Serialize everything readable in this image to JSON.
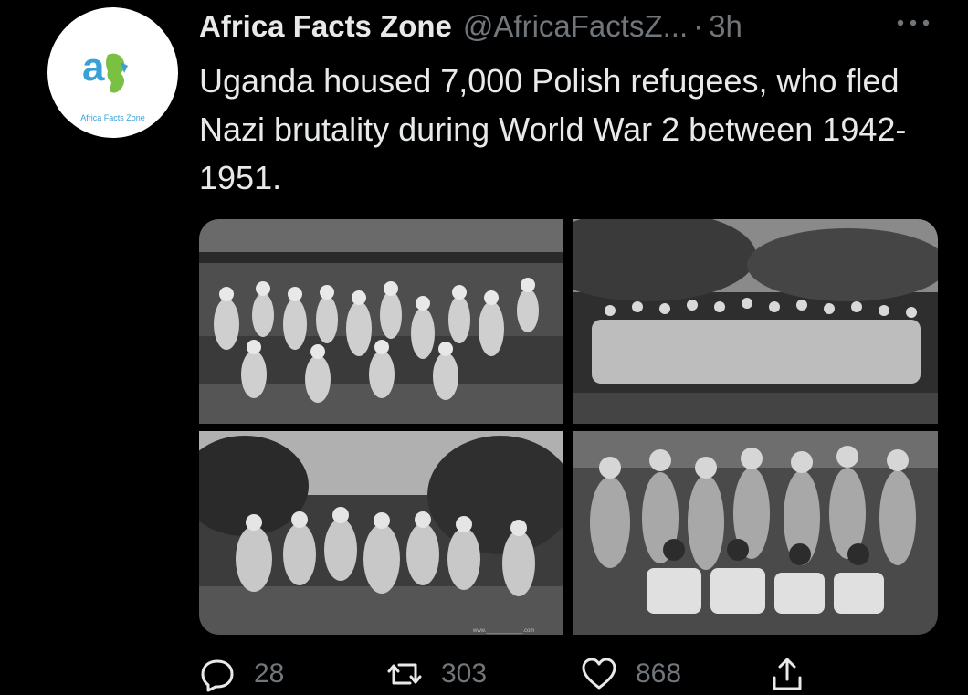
{
  "tweet": {
    "display_name": "Africa Facts Zone",
    "handle": "@AfricaFactsZ...",
    "separator": "·",
    "time": "3h",
    "text": "Uganda housed 7,000 Polish refugees, who fled Nazi brutality during World War 2 between 1942-1951.",
    "avatar": {
      "logo_text": "Africa Facts Zone",
      "icon": "africa-facts-zone-logo"
    },
    "media": [
      {
        "icon": "photo-children-thatched-hut"
      },
      {
        "icon": "photo-group-under-trees"
      },
      {
        "icon": "photo-group-in-garden"
      },
      {
        "icon": "photo-group-with-soldiers"
      }
    ],
    "photo_credit": "www.____________.com",
    "actions": {
      "replies": "28",
      "retweets": "303",
      "likes": "868"
    }
  },
  "colors": {
    "background": "#000000",
    "primary_text": "#e7e9ea",
    "secondary_text": "#71767b"
  }
}
